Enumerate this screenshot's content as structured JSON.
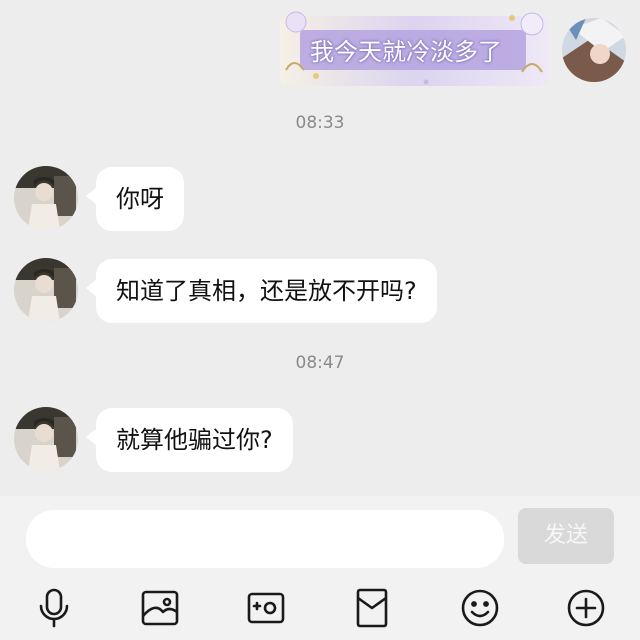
{
  "messages": {
    "sent_sticker_text": "我今天就冷淡多了",
    "time_1": "08:33",
    "recv_1": "你呀",
    "recv_2": "知道了真相，还是放不开吗?",
    "time_2": "08:47",
    "recv_3": "就算他骗过你?"
  },
  "input": {
    "placeholder": "",
    "value": "",
    "send_label": "发送"
  },
  "toolbar": {
    "icons": [
      "microphone-icon",
      "image-icon",
      "camera-icon",
      "red-packet-icon",
      "emoji-icon",
      "plus-icon"
    ]
  },
  "colors": {
    "background": "#ededed",
    "bubble": "#ffffff",
    "send_disabled": "#d9d9d9",
    "timestamp": "#8a8a8a"
  }
}
